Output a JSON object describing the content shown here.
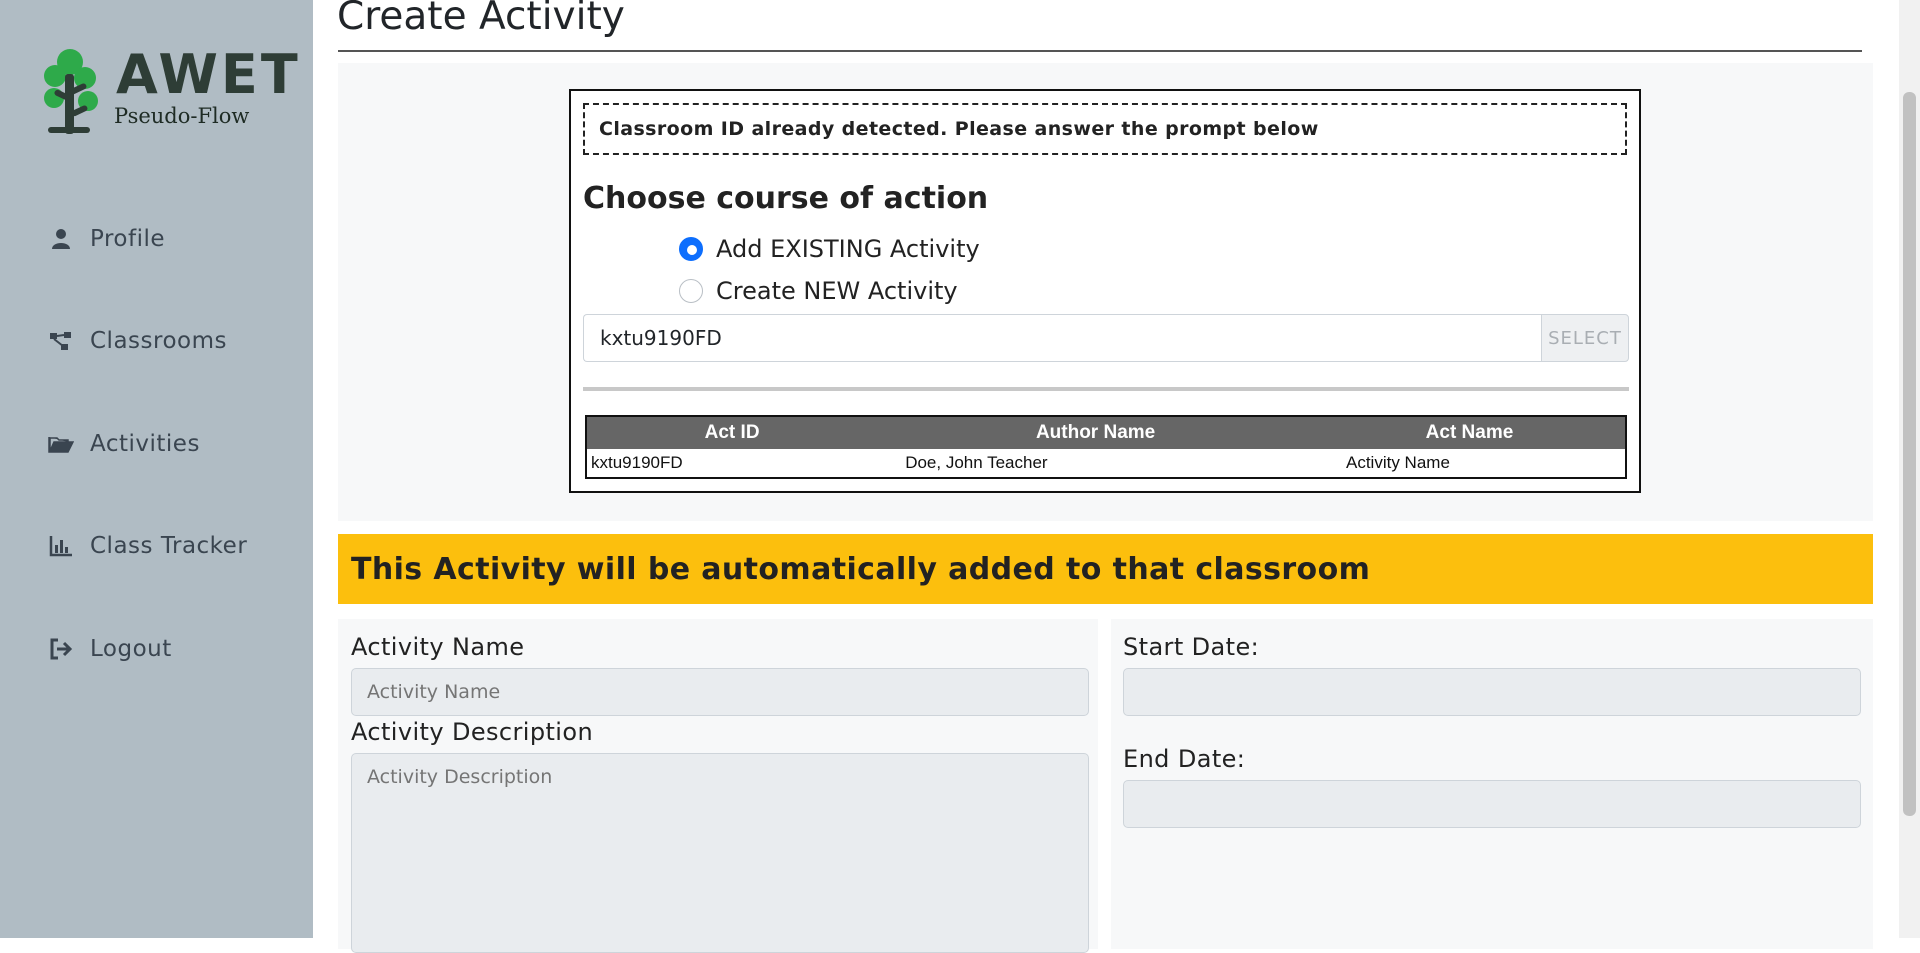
{
  "sidebar": {
    "logo": {
      "brand": "AWET",
      "tagline": "Pseudo-Flow"
    },
    "items": [
      {
        "label": "Profile",
        "icon": "user-icon"
      },
      {
        "label": "Classrooms",
        "icon": "network-icon"
      },
      {
        "label": "Activities",
        "icon": "folder-open-icon"
      },
      {
        "label": "Class Tracker",
        "icon": "bar-chart-icon"
      },
      {
        "label": "Logout",
        "icon": "sign-out-icon"
      }
    ]
  },
  "page": {
    "title": "Create Activity"
  },
  "prompt": {
    "notice": "Classroom ID already detected. Please answer the prompt below",
    "heading": "Choose course of action",
    "options": [
      {
        "label": "Add EXISTING Activity",
        "selected": true
      },
      {
        "label": "Create NEW Activity",
        "selected": false
      }
    ],
    "search": {
      "value": "kxtu9190FD",
      "button": "SELECT"
    },
    "table": {
      "headers": [
        "Act ID",
        "Author Name",
        "Act Name"
      ],
      "rows": [
        [
          "kxtu9190FD",
          "Doe, John Teacher",
          "Activity Name"
        ]
      ]
    }
  },
  "banner": "This Activity will be automatically added to that classroom",
  "form": {
    "name_label": "Activity Name",
    "name_placeholder": "Activity Name",
    "description_label": "Activity Description",
    "description_placeholder": "Activity Description",
    "start_label": "Start Date:",
    "end_label": "End Date:"
  },
  "colors": {
    "sidebar": "#b0bcc4",
    "banner": "#fcbf0d",
    "radio_selected": "#0d6efd",
    "logo_green": "#2eaa4a"
  }
}
